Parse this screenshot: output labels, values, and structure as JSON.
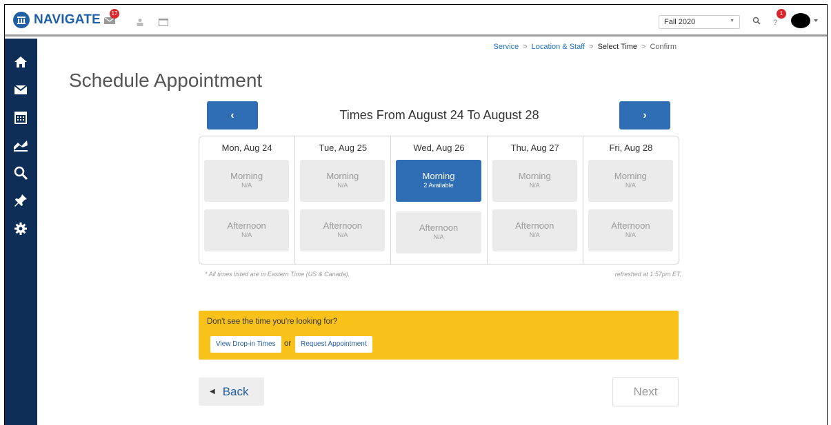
{
  "header": {
    "logo_text": "NAVIGATE",
    "message_badge": "17",
    "term_value": "Fall 2020",
    "alert_badge": "1"
  },
  "breadcrumb": {
    "step1": "Service",
    "step2": "Location & Staff",
    "step3": "Select Time",
    "step4": "Confirm",
    "separator": ">"
  },
  "page": {
    "title": "Schedule Appointment",
    "week_title": "Times From August 24 To August 28",
    "prev_label": "‹",
    "next_label": "›"
  },
  "days": [
    {
      "label": "Mon, Aug 24",
      "morning": {
        "name": "Morning",
        "status": "N/A"
      },
      "afternoon": {
        "name": "Afternoon",
        "status": "N/A"
      }
    },
    {
      "label": "Tue, Aug 25",
      "morning": {
        "name": "Morning",
        "status": "N/A"
      },
      "afternoon": {
        "name": "Afternoon",
        "status": "N/A"
      }
    },
    {
      "label": "Wed, Aug 26",
      "morning": {
        "name": "Morning",
        "status": "2 Available"
      },
      "afternoon": {
        "name": "Afternoon",
        "status": "N/A"
      }
    },
    {
      "label": "Thu, Aug 27",
      "morning": {
        "name": "Morning",
        "status": "N/A"
      },
      "afternoon": {
        "name": "Afternoon",
        "status": "N/A"
      }
    },
    {
      "label": "Fri, Aug 28",
      "morning": {
        "name": "Morning",
        "status": "N/A"
      },
      "afternoon": {
        "name": "Afternoon",
        "status": "N/A"
      }
    }
  ],
  "footnotes": {
    "timezone": "* All times listed are in Eastern Time (US & Canada).",
    "refreshed": "refreshed at 1:57pm ET."
  },
  "help": {
    "text": "Don't see the time you're looking for?",
    "dropin_label": "View Drop-in Times",
    "or_label": "or",
    "request_label": "Request Appointment"
  },
  "footer": {
    "back_label": "Back",
    "next_label": "Next"
  },
  "colors": {
    "brand_blue": "#2f6db5",
    "sidebar_navy": "#0f2e57",
    "help_yellow": "#f8c21b",
    "badge_red": "#d9262b"
  }
}
